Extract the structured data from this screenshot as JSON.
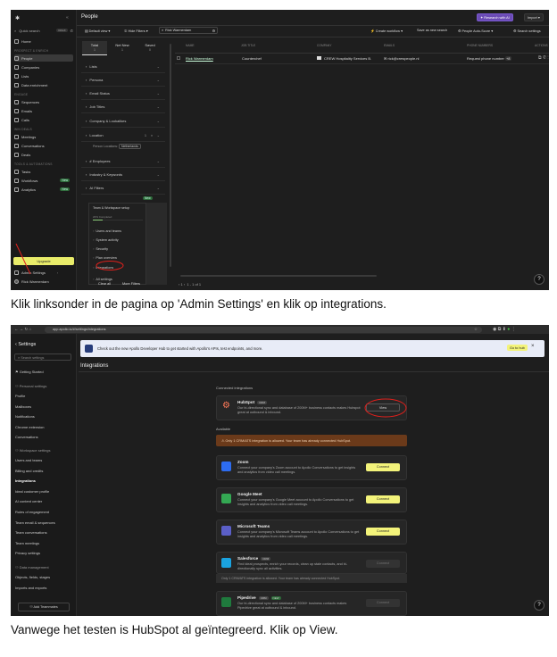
{
  "screen1": {
    "page_title": "People",
    "research_btn": "Research with AI",
    "import_btn": "Import",
    "quick_search": "Quick search",
    "shortcut": "Ctrl+K",
    "nav_groups": [
      {
        "label": "",
        "items": [
          "Home"
        ]
      },
      {
        "label": "PROSPECT & ENRICH",
        "items": [
          "People",
          "Companies",
          "Lists",
          "Data enrichment"
        ]
      },
      {
        "label": "ENGAGE",
        "items": [
          "Sequences",
          "Emails",
          "Calls"
        ]
      },
      {
        "label": "WIN DEALS",
        "items": [
          "Meetings",
          "Conversations",
          "Deals"
        ]
      },
      {
        "label": "TOOLS & AUTOMATIONS",
        "items": [
          "Tasks",
          "Workflows",
          "Analytics"
        ]
      }
    ],
    "new_badge": "New",
    "upgrade_btn": "Upgrade",
    "admin_settings": "Admin Settings",
    "user_name": "Rick Warmerdam",
    "toolbar": {
      "default_view": "Default view",
      "hide_filters": "Hide Filters",
      "search_value": "Rick Warmerdam",
      "create_workflow": "Create workflow",
      "save_search": "Save as new search",
      "auto_score": "People Auto-Score",
      "search_settings": "Search settings"
    },
    "tabs": [
      {
        "label": "Total",
        "count": "1"
      },
      {
        "label": "Net New",
        "count": "1"
      },
      {
        "label": "Saved",
        "count": "0"
      }
    ],
    "filters": [
      "Lists",
      "Persona",
      "Email Status",
      "Job Titles",
      "Company & Lookalikes",
      "Location",
      "# Employees",
      "Industry & Keywords",
      "AI Filters"
    ],
    "location_sub": "Person Locations:",
    "location_tag": "Netherlands",
    "location_count": "1",
    "setup_title": "Team & Workspace setup",
    "setup_progress": "20% Completed",
    "setup_progress_value": 0.2,
    "menu_items": [
      "Users and teams",
      "System activity",
      "Security",
      "Plan overview",
      "Integrations",
      "All settings"
    ],
    "clear_all": "Clear all",
    "more_filters": "More Filters",
    "pagination": "1 - 1 of 1",
    "page_num": "1",
    "table_headers": [
      "NAME",
      "JOB TITLE",
      "COMPANY",
      "EMAILS",
      "PHONE NUMBERS",
      "ACTIONS"
    ],
    "row": {
      "name": "Rick Warmerdam",
      "job_title": "Counterchef",
      "company": "CREW Hospitality Services B.",
      "email": "rick@crewpeople.nl",
      "phone": "Request phone number",
      "phone_badge": "+8"
    }
  },
  "caption1": "Klik linksonder in de pagina op 'Admin Settings' en klik op integrations.",
  "screen2": {
    "url": "app.apollo.io/#/settings/integrations",
    "settings_title": "Settings",
    "search_placeholder": "Search settings",
    "getting_started": "Getting Started",
    "personal_header": "Personal settings",
    "personal_items": [
      "Profile",
      "Mailboxes",
      "Notifications",
      "Chrome extension",
      "Conversations"
    ],
    "workspace_header": "Workspace settings",
    "workspace_items": [
      "Users and teams",
      "Billing and credits",
      "Integrations",
      "Ideal customer profile",
      "AI content center",
      "Rules of engagement",
      "Team email & sequences",
      "Team conversations",
      "Team meetings",
      "Privacy settings"
    ],
    "data_header": "Data management",
    "data_items": [
      "Objects, fields, stages",
      "Imports and exports"
    ],
    "add_teammates": "Add Teammates",
    "banner_text": "Check out the new Apollo Developer Hub to get started with Apollo's APIs, test endpoints, and more.",
    "banner_btn": "Go to hub",
    "page_title": "Integrations",
    "connected_header": "Connected integrations",
    "hubspot": {
      "name": "HubSpot",
      "tag": "CRM",
      "desc": "Our bi-directional sync and database of 200M+ business contacts makes Hubspot great at outbound & inbound.",
      "btn": "View"
    },
    "available_header": "Available",
    "warning": "Only 1 CRM/ATS integration is allowed. Your team has already connected HubSpot.",
    "integrations": [
      {
        "name": "Zoom",
        "tag": "",
        "desc": "Connect your company's Zoom account to Apollo Conversations to get insights and analytics from video call meetings.",
        "btn": "Connect",
        "color": "#2d6cf0"
      },
      {
        "name": "Google Meet",
        "tag": "",
        "desc": "Connect your company's Google Meet account to Apollo Conversations to get insights and analytics from video call meetings.",
        "btn": "Connect",
        "color": "#34a853"
      },
      {
        "name": "Microsoft Teams",
        "tag": "",
        "desc": "Connect your company's Microsoft Teams account to Apollo Conversations to get insights and analytics from video call meetings.",
        "btn": "Connect",
        "color": "#5b5fc7"
      },
      {
        "name": "Salesforce",
        "tag": "CRM",
        "desc": "Find ideal prospects, enrich your records, clean up stale contacts, and bi-directionally sync all activities.",
        "btn": "Connect",
        "color": "#1aa3e0"
      },
      {
        "name": "Pipedrive",
        "tag": "CRM",
        "tag2": "NEW",
        "desc": "Our bi-directional sync and database of 200M+ business contacts makes Pipedrive great at outbound & inbound.",
        "btn": "Connect",
        "color": "#1f7a3d"
      }
    ],
    "sf_note": "Only 1 CRM/ATS integration is allowed. Your team has already connected HubSpot."
  },
  "caption2": "Vanwege het testen is HubSpot al geïntegreerd. Klik op View.",
  "colors": {
    "accent_yellow": "#f3f37a",
    "annotation_red": "#e0201c",
    "dark_bg": "#1e1e1e",
    "warning_bg": "#6b3a1a"
  }
}
